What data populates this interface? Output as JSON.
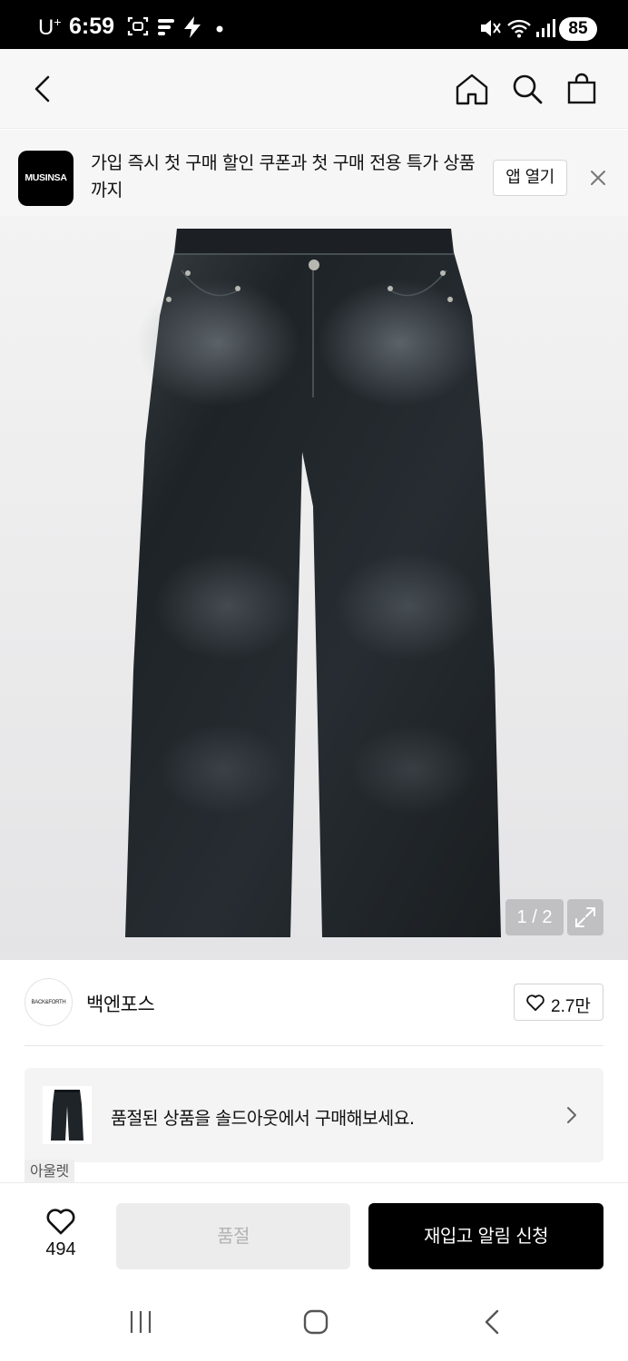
{
  "status_bar": {
    "carrier": "U",
    "carrier_sup": "+",
    "time": "6:59",
    "battery": "85",
    "icons": [
      "screenshot-icon",
      "flow-icon",
      "bolt-icon",
      "dot-icon",
      "mute-icon",
      "wifi-icon",
      "signal-icon"
    ]
  },
  "header": {
    "icons": [
      "back-icon",
      "home-icon",
      "search-icon",
      "shopping-bag-icon"
    ]
  },
  "app_banner": {
    "logo_text": "MUSINSA",
    "text": "가입 즉시 첫 구매 할인 쿠폰과 첫 구매 전용 특가 상품까지",
    "open_app_label": "앱 열기",
    "close_icon": "close-icon"
  },
  "product_image": {
    "counter": "1 / 2",
    "expand_icon": "expand-icon"
  },
  "brand": {
    "logo_text": "BACK&FORTH",
    "name": "백엔포스",
    "like_count": "2.7만"
  },
  "soldout_card": {
    "text": "품절된 상품을 솔드아웃에서 구매해보세요.",
    "tag": "아울렛"
  },
  "bottom_bar": {
    "wish_count": "494",
    "soldout_label": "품절",
    "restock_label": "재입고 알림 신청"
  },
  "nav_bar": {
    "icons": [
      "recent-apps-icon",
      "home-nav-icon",
      "back-nav-icon"
    ]
  },
  "colors": {
    "primary_button": "#000000",
    "disabled_button": "#ececec",
    "disabled_text": "#b3b3b3"
  }
}
